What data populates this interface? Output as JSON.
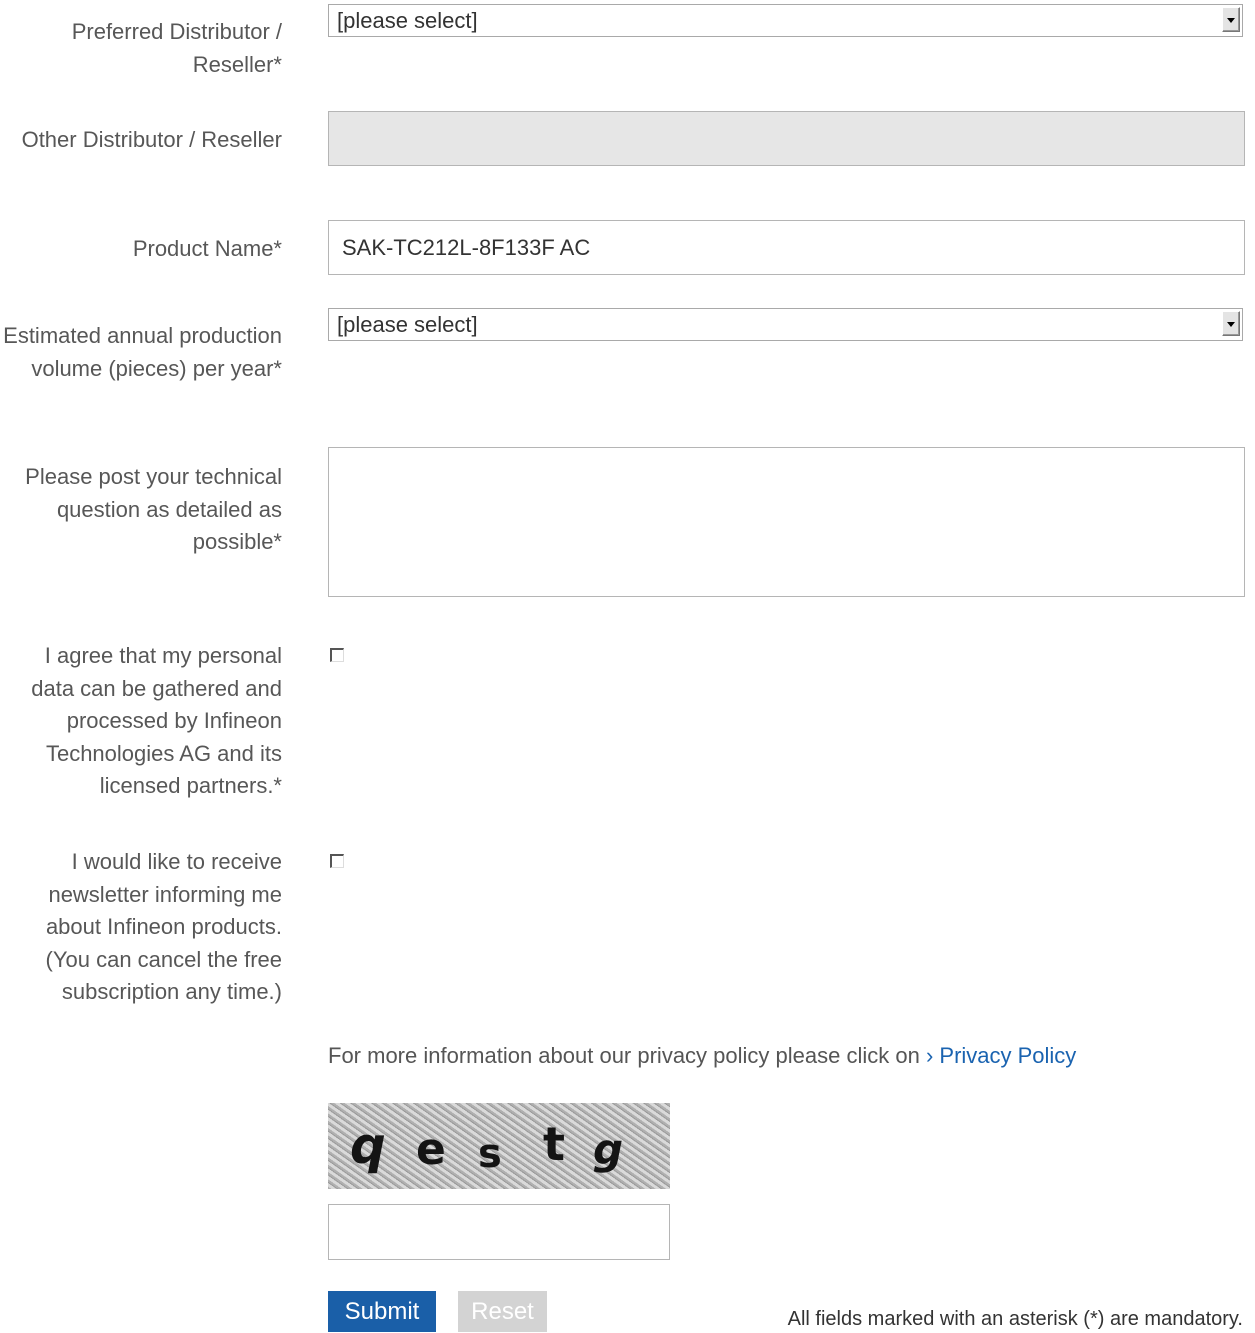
{
  "fields": {
    "distributor_label": "Preferred Distributor / Reseller*",
    "distributor_value": "[please select]",
    "other_distributor_label": "Other Distributor / Reseller",
    "other_distributor_value": "",
    "product_label": "Product Name*",
    "product_value": "SAK-TC212L-8F133F AC",
    "volume_label": "Estimated annual production volume (pieces) per year*",
    "volume_value": "[please select]",
    "question_label": "Please post your technical question as detailed as possible*",
    "question_value": "",
    "agree_label": "I agree that my personal data can be gathered and processed by Infineon Technologies AG and its licensed partners.*",
    "newsletter_label": "I would like to receive newsletter informing me about Infineon products. (You can cancel the free subscription any time.)"
  },
  "privacy": {
    "text": "For more information about our privacy policy please click on",
    "link_label": "› Privacy Policy"
  },
  "captcha": {
    "chars": [
      "q",
      "e",
      "s",
      "t",
      "g"
    ],
    "input_value": ""
  },
  "buttons": {
    "submit_label": "Submit",
    "reset_label": "Reset"
  },
  "mandatory_note": "All fields marked with an asterisk (*) are mandatory.",
  "colors": {
    "submit_bg": "#1a5fa8",
    "reset_bg": "#d3d3d3",
    "link": "#1a63b0"
  }
}
